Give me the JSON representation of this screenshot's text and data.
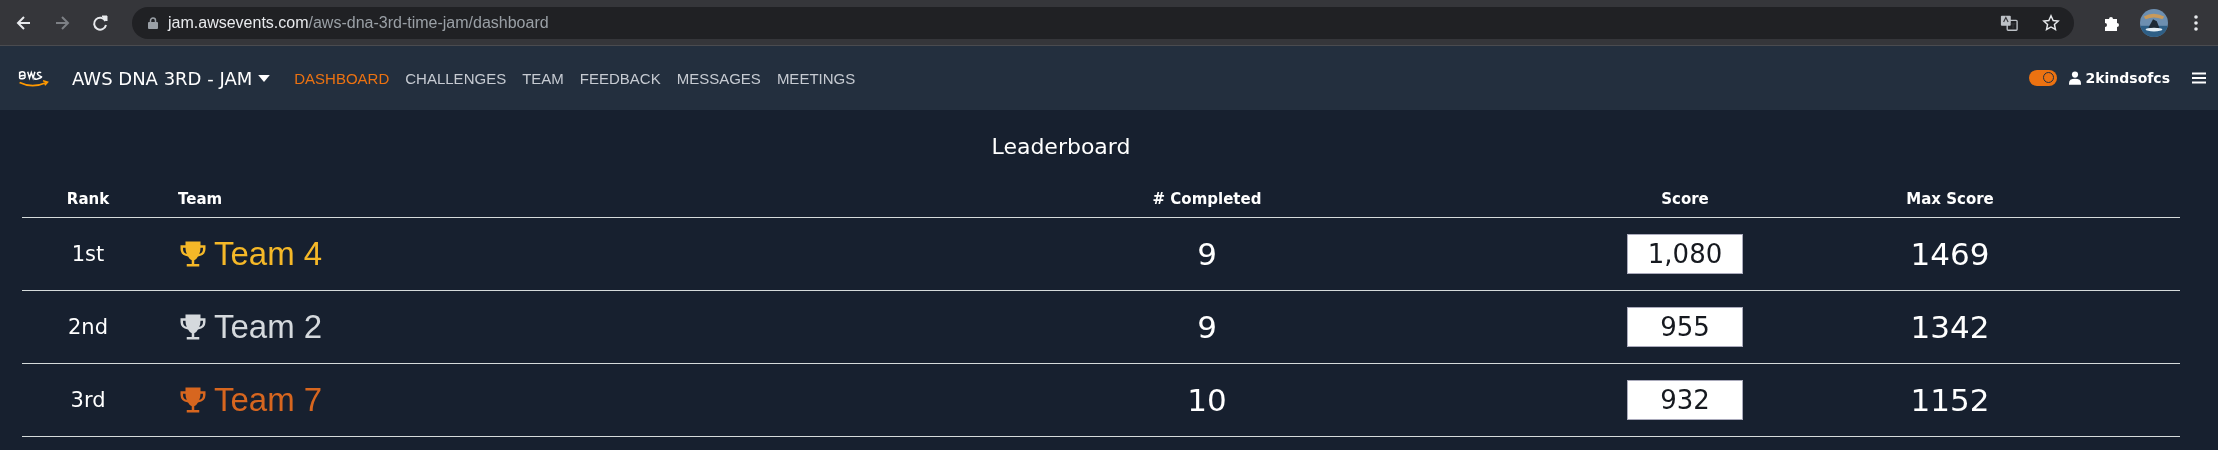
{
  "browser": {
    "url_host": "jam.awsevents.com",
    "url_path": "/aws-dna-3rd-time-jam/dashboard",
    "forward_disabled": true
  },
  "navbar": {
    "event_title": "AWS DNA 3RD - JAM",
    "items": [
      {
        "label": "DASHBOARD",
        "selected": true
      },
      {
        "label": "CHALLENGES",
        "selected": false
      },
      {
        "label": "TEAM",
        "selected": false
      },
      {
        "label": "FEEDBACK",
        "selected": false
      },
      {
        "label": "MESSAGES",
        "selected": false
      },
      {
        "label": "MEETINGS",
        "selected": false
      }
    ],
    "theme_toggle": {
      "on": true
    },
    "username": "2kindsofcs"
  },
  "leaderboard": {
    "title": "Leaderboard",
    "columns": [
      "Rank",
      "Team",
      "# Completed",
      "Score",
      "Max Score"
    ],
    "rows": [
      {
        "rank": "1st",
        "team": "Team 4",
        "color": "#f5b828",
        "completed": "9",
        "score": "1,080",
        "max_score": "1469"
      },
      {
        "rank": "2nd",
        "team": "Team 2",
        "color": "#d5d9dd",
        "completed": "9",
        "score": "955",
        "max_score": "1342"
      },
      {
        "rank": "3rd",
        "team": "Team 7",
        "color": "#d7661f",
        "completed": "10",
        "score": "932",
        "max_score": "1152"
      }
    ]
  }
}
